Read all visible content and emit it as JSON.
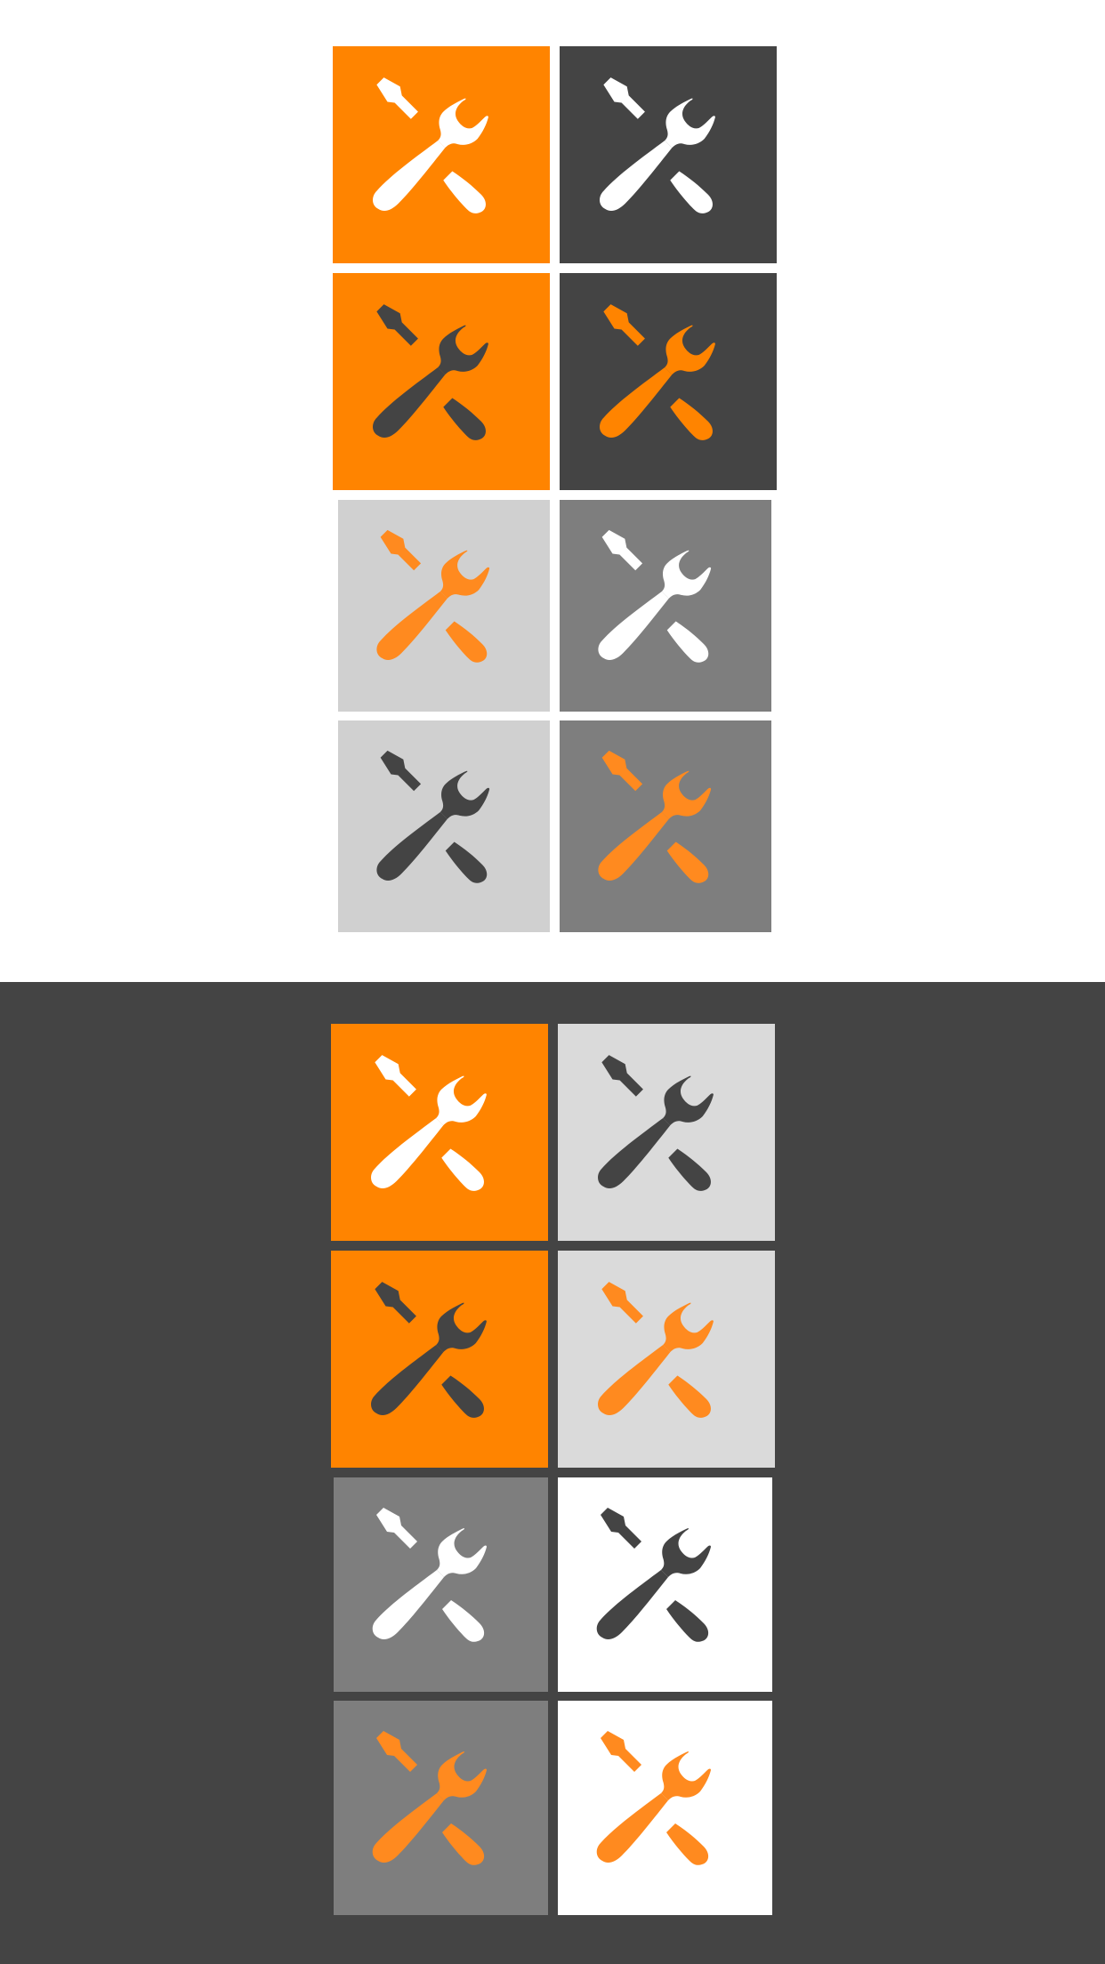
{
  "colors": {
    "orange": "#FF8400",
    "orange_soft": "#FF8A1F",
    "charcoal": "#444444",
    "white": "#FFFFFF",
    "light_gray": "#D0D0D0",
    "pale_gray": "#DADADA",
    "mid_gray": "#7E7E7E"
  },
  "sections": [
    {
      "name": "light-background",
      "background": "#FFFFFF",
      "tiles": [
        {
          "name": "tile-orange-white",
          "bg": "#FF8400",
          "icon": "tools-icon",
          "icon_color": "#FFFFFF"
        },
        {
          "name": "tile-charcoal-white",
          "bg": "#444444",
          "icon": "tools-icon",
          "icon_color": "#FFFFFF"
        },
        {
          "name": "tile-orange-charcoal",
          "bg": "#FF8400",
          "icon": "tools-icon",
          "icon_color": "#444444"
        },
        {
          "name": "tile-charcoal-orange",
          "bg": "#444444",
          "icon": "tools-icon",
          "icon_color": "#FF8400"
        },
        {
          "name": "tile-lightgray-orange",
          "bg": "#D0D0D0",
          "icon": "tools-icon",
          "icon_color": "#FF8A1F"
        },
        {
          "name": "tile-midgray-white",
          "bg": "#7E7E7E",
          "icon": "tools-icon",
          "icon_color": "#FFFFFF"
        },
        {
          "name": "tile-lightgray-charcoal",
          "bg": "#D0D0D0",
          "icon": "tools-icon",
          "icon_color": "#444444"
        },
        {
          "name": "tile-midgray-orange",
          "bg": "#7E7E7E",
          "icon": "tools-icon",
          "icon_color": "#FF8A1F"
        }
      ]
    },
    {
      "name": "dark-background",
      "background": "#444444",
      "tiles": [
        {
          "name": "tile-orange-white",
          "bg": "#FF8400",
          "icon": "tools-icon",
          "icon_color": "#FFFFFF"
        },
        {
          "name": "tile-palegray-charcoal",
          "bg": "#DADADA",
          "icon": "tools-icon",
          "icon_color": "#444444"
        },
        {
          "name": "tile-orange-charcoal",
          "bg": "#FF8400",
          "icon": "tools-icon",
          "icon_color": "#444444"
        },
        {
          "name": "tile-palegray-orange",
          "bg": "#DADADA",
          "icon": "tools-icon",
          "icon_color": "#FF8A1F"
        },
        {
          "name": "tile-midgray-white",
          "bg": "#7E7E7E",
          "icon": "tools-icon",
          "icon_color": "#FFFFFF"
        },
        {
          "name": "tile-white-charcoal",
          "bg": "#FFFFFF",
          "icon": "tools-icon",
          "icon_color": "#444444"
        },
        {
          "name": "tile-midgray-orange",
          "bg": "#7E7E7E",
          "icon": "tools-icon",
          "icon_color": "#FF8A1F"
        },
        {
          "name": "tile-white-orange",
          "bg": "#FFFFFF",
          "icon": "tools-icon",
          "icon_color": "#FF8A1F"
        }
      ]
    }
  ]
}
